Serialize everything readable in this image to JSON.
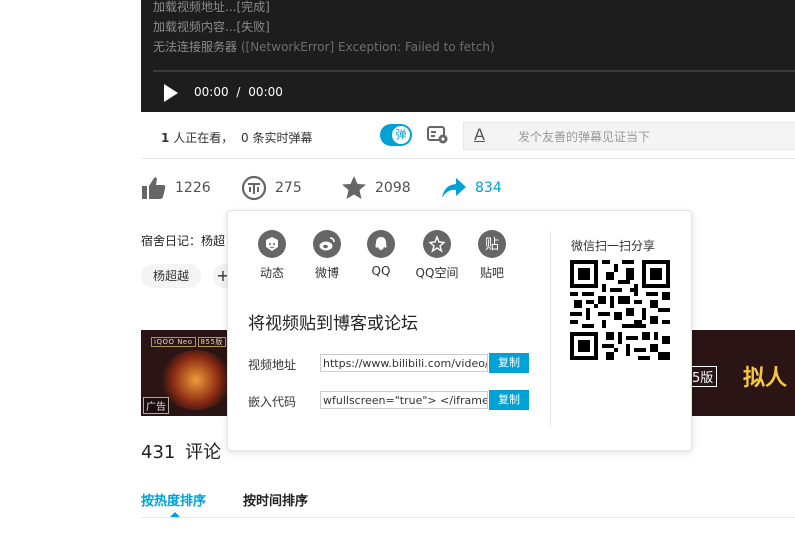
{
  "player": {
    "log_lines": [
      {
        "text": "加载视频地址...[完成]",
        "muted": ""
      },
      {
        "text": "加载视频内容...[失败]",
        "muted": ""
      },
      {
        "text": "无法连接服务器 ",
        "muted": "([NetworkError] Exception: Failed to fetch)"
      }
    ],
    "current_time": "00:00",
    "separator": "/",
    "total_time": "00:00"
  },
  "danmaku": {
    "viewer_count": "1",
    "viewer_text": "人正在看，",
    "realtime_count": "0",
    "realtime_text": "条实时弹幕",
    "toggle_label": "弹",
    "toggle_on": true,
    "input_icon": "A",
    "input_placeholder": "发个友善的弹幕见证当下"
  },
  "actions": {
    "like": "1226",
    "coin": "275",
    "favorite": "2098",
    "share": "834"
  },
  "description": "宿舍日记：杨超",
  "tags": [
    "杨超越"
  ],
  "tag_add": "+",
  "ad": {
    "brand": "iQOO Neo",
    "brand_badge": "855版",
    "badge": "广告",
    "right_text": "5版",
    "big_text": "拟人"
  },
  "comments": {
    "count": "431",
    "label": "评论",
    "sort_hot": "按热度排序",
    "sort_time": "按时间排序"
  },
  "share_popup": {
    "items": [
      {
        "label": "动态",
        "icon": "dynamic-icon"
      },
      {
        "label": "微博",
        "icon": "weibo-icon"
      },
      {
        "label": "QQ",
        "icon": "qq-icon"
      },
      {
        "label": "QQ空间",
        "icon": "qzone-icon"
      },
      {
        "label": "贴吧",
        "icon": "tieba-icon",
        "glyph": "贴"
      }
    ],
    "title": "将视频贴到博客或论坛",
    "video_url_label": "视频地址",
    "video_url_value": "https://www.bilibili.com/video/a",
    "embed_label": "嵌入代码",
    "embed_value": "wfullscreen=\"true\"> </iframe>",
    "copy_label": "复制",
    "qr_title": "微信扫一扫分享"
  },
  "colors": {
    "accent": "#00a1d6",
    "icon_gray": "#666666",
    "player_bg": "#1d1d1d"
  }
}
